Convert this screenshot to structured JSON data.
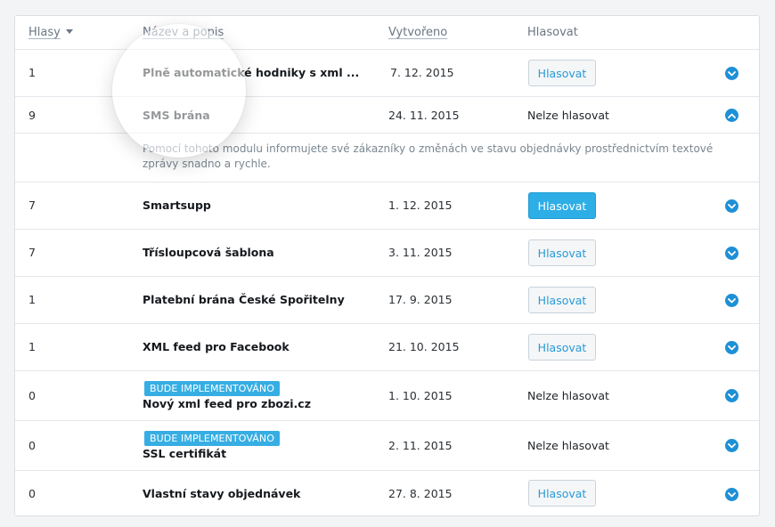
{
  "columns": {
    "votes": "Hlasy",
    "name": "Název a popis",
    "created": "Vytvořeno",
    "vote": "Hlasovat"
  },
  "rows": [
    {
      "votes": "1",
      "title": "Plně automatické hodniky s xml ...",
      "date": "7. 12. 2015",
      "action": "Hlasovat",
      "action_type": "button",
      "expanded": false
    },
    {
      "votes": "9",
      "title": "SMS brána",
      "date": "24. 11. 2015",
      "action": "Nelze hlasovat",
      "action_type": "text",
      "expanded": true,
      "description": "Pomocí tohoto modulu informujete své zákazníky o změnách ve stavu objednávky prostřednictvím textové zprávy snadno a rychle."
    },
    {
      "votes": "7",
      "title": "Smartsupp",
      "date": "1. 12. 2015",
      "action": "Hlasovat",
      "action_type": "button-primary",
      "expanded": false
    },
    {
      "votes": "7",
      "title": "Třísloupcová šablona",
      "date": "3. 11. 2015",
      "action": "Hlasovat",
      "action_type": "button",
      "expanded": false
    },
    {
      "votes": "1",
      "title": "Platební brána České Spořitelny",
      "date": "17. 9. 2015",
      "action": "Hlasovat",
      "action_type": "button",
      "expanded": false
    },
    {
      "votes": "1",
      "title": "XML feed pro Facebook",
      "date": "21. 10. 2015",
      "action": "Hlasovat",
      "action_type": "button",
      "expanded": false
    },
    {
      "votes": "0",
      "badge": "BUDE IMPLEMENTOVÁNO",
      "title": "Nový xml feed pro zbozi.cz",
      "date": "1. 10. 2015",
      "action": "Nelze hlasovat",
      "action_type": "text",
      "expanded": false
    },
    {
      "votes": "0",
      "badge": "BUDE IMPLEMENTOVÁNO",
      "title": "SSL certifikát",
      "date": "2. 11. 2015",
      "action": "Nelze hlasovat",
      "action_type": "text",
      "expanded": false
    },
    {
      "votes": "0",
      "title": "Vlastní stavy objednávek",
      "date": "27. 8. 2015",
      "action": "Hlasovat",
      "action_type": "button",
      "expanded": false
    }
  ],
  "colors": {
    "accent": "#2eaee6",
    "toggle": "#1e90d6",
    "badge": "#37aee3"
  },
  "icons": {
    "sort": "caret-down-icon",
    "expand": "chevron-down-icon",
    "collapse": "chevron-up-icon"
  }
}
